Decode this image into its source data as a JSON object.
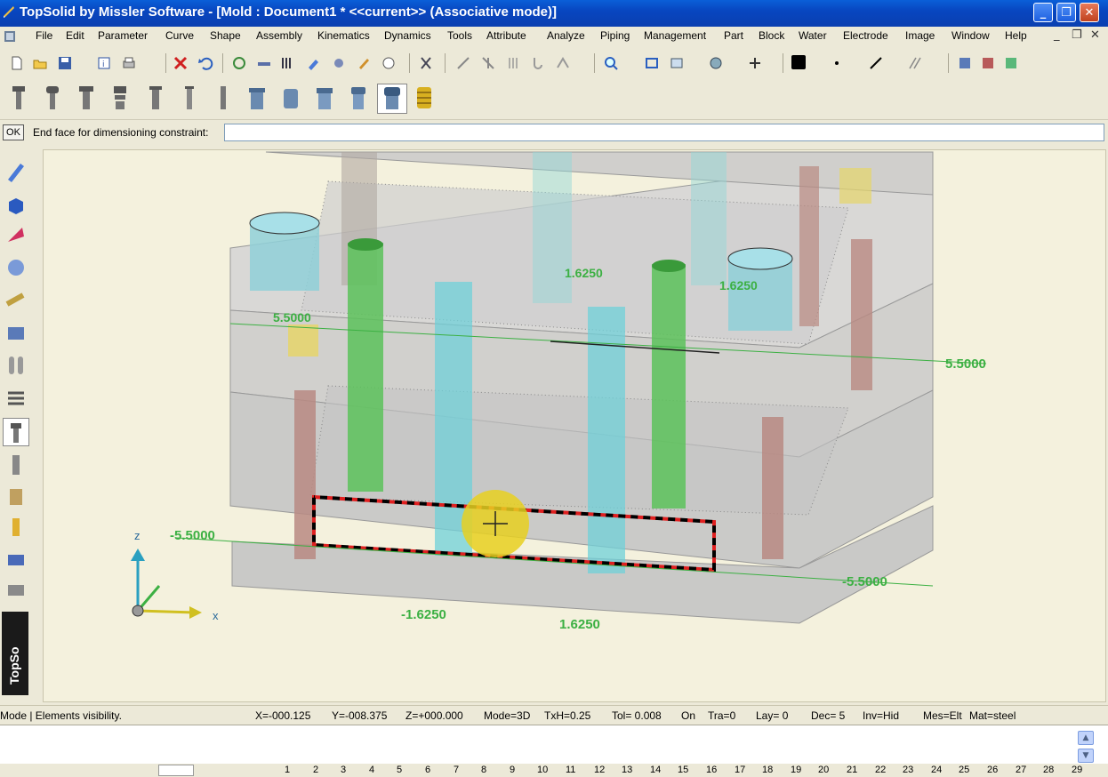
{
  "window": {
    "title": "TopSolid by Missler Software - [Mold : Document1 *  <<current>> (Associative mode)]",
    "minimize_glyph": "_",
    "restore_glyph": "❐",
    "close_glyph": "✕"
  },
  "menu": {
    "items": [
      "File",
      "Edit",
      "Parameter",
      "Curve",
      "Shape",
      "Assembly",
      "Kinematics",
      "Dynamics",
      "Tools",
      "Attribute",
      "Analyze",
      "Piping",
      "Management",
      "Part",
      "Block",
      "Water",
      "Electrode",
      "Image",
      "Window",
      "Help"
    ],
    "doc_min": "_",
    "doc_restore": "❐",
    "doc_close": "✕"
  },
  "prompt": {
    "ok_label": "OK",
    "label": "End face for dimensioning constraint:",
    "value": ""
  },
  "viewport": {
    "dimensions": [
      "5.5000",
      "1.6250",
      "1.6250",
      "5.5000",
      "-5.5000",
      "-5.5000",
      "-1.6250",
      "1.6250"
    ],
    "axes": {
      "z": "z",
      "x": "x"
    }
  },
  "brand": {
    "text": "TopSo"
  },
  "status": {
    "mode": "Mode | Elements visibility.",
    "x": "X=-000.125",
    "y": "Y=-008.375",
    "z": "Z=+000.000",
    "mode3d": "Mode=3D",
    "txh": "TxH=0.25",
    "tol": "Tol= 0.008",
    "on": "On",
    "tra": "Tra=0",
    "lay": "Lay= 0",
    "dec": "Dec= 5",
    "inv": "Inv=Hid",
    "mes": "Mes=Elt",
    "mat": "Mat=steel"
  },
  "layers": [
    "1",
    "2",
    "3",
    "4",
    "5",
    "6",
    "7",
    "8",
    "9",
    "10",
    "11",
    "12",
    "13",
    "14",
    "15",
    "16",
    "17",
    "18",
    "19",
    "20",
    "21",
    "22",
    "23",
    "24",
    "25",
    "26",
    "27",
    "28",
    "29"
  ],
  "colors": {
    "dim_text": "#3cb043",
    "selection_dash": "#e02020",
    "cursor_glow": "#e8d020"
  }
}
